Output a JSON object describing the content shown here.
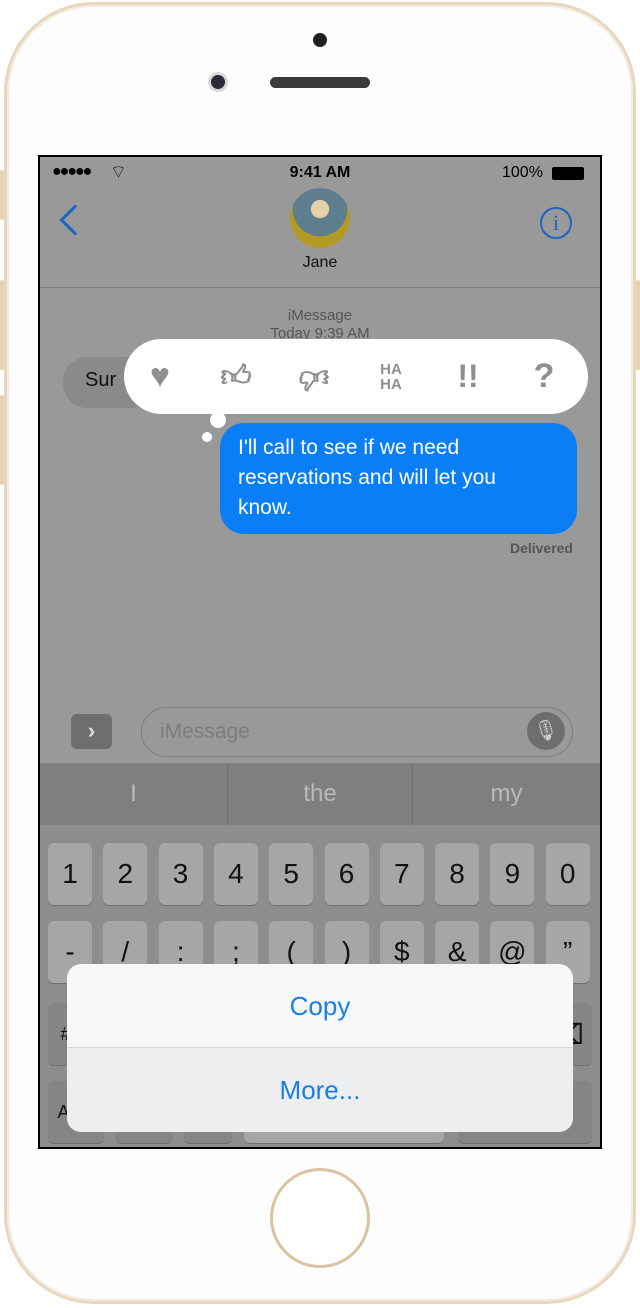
{
  "status": {
    "time": "9:41 AM",
    "battery": "100%"
  },
  "nav": {
    "contact": "Jane",
    "back_icon": "chevron-left-icon",
    "info_icon": "info-icon"
  },
  "thread": {
    "service": "iMessage",
    "timestamp": "Today 9:39 AM",
    "incoming": "Sur",
    "outgoing_lines": [
      "I'll call to see if we need",
      "reservations and will let you",
      "know."
    ],
    "delivery": "Delivered"
  },
  "tapbacks": [
    {
      "icon": "heart-icon"
    },
    {
      "icon": "thumbs-up-icon"
    },
    {
      "icon": "thumbs-down-icon"
    },
    {
      "icon": "haha-icon",
      "label": "HA HA"
    },
    {
      "icon": "exclamation-icon",
      "label": "!!"
    },
    {
      "icon": "question-icon",
      "label": "?"
    }
  ],
  "composer": {
    "placeholder": "iMessage"
  },
  "predictions": [
    "I",
    "the",
    "my"
  ],
  "keyboard": {
    "row1": [
      "1",
      "2",
      "3",
      "4",
      "5",
      "6",
      "7",
      "8",
      "9",
      "0"
    ],
    "row2": [
      "-",
      "/",
      ":",
      ";",
      "(",
      ")",
      "$",
      "&",
      "@",
      "”"
    ],
    "row3_left": "#+=",
    "row4_left": "ABC"
  },
  "action_sheet": {
    "copy": "Copy",
    "more": "More..."
  },
  "colors": {
    "accent": "#1a7ee6",
    "bubble_blue": "#0a84ff",
    "frame_gold": "#e8d6bd"
  }
}
